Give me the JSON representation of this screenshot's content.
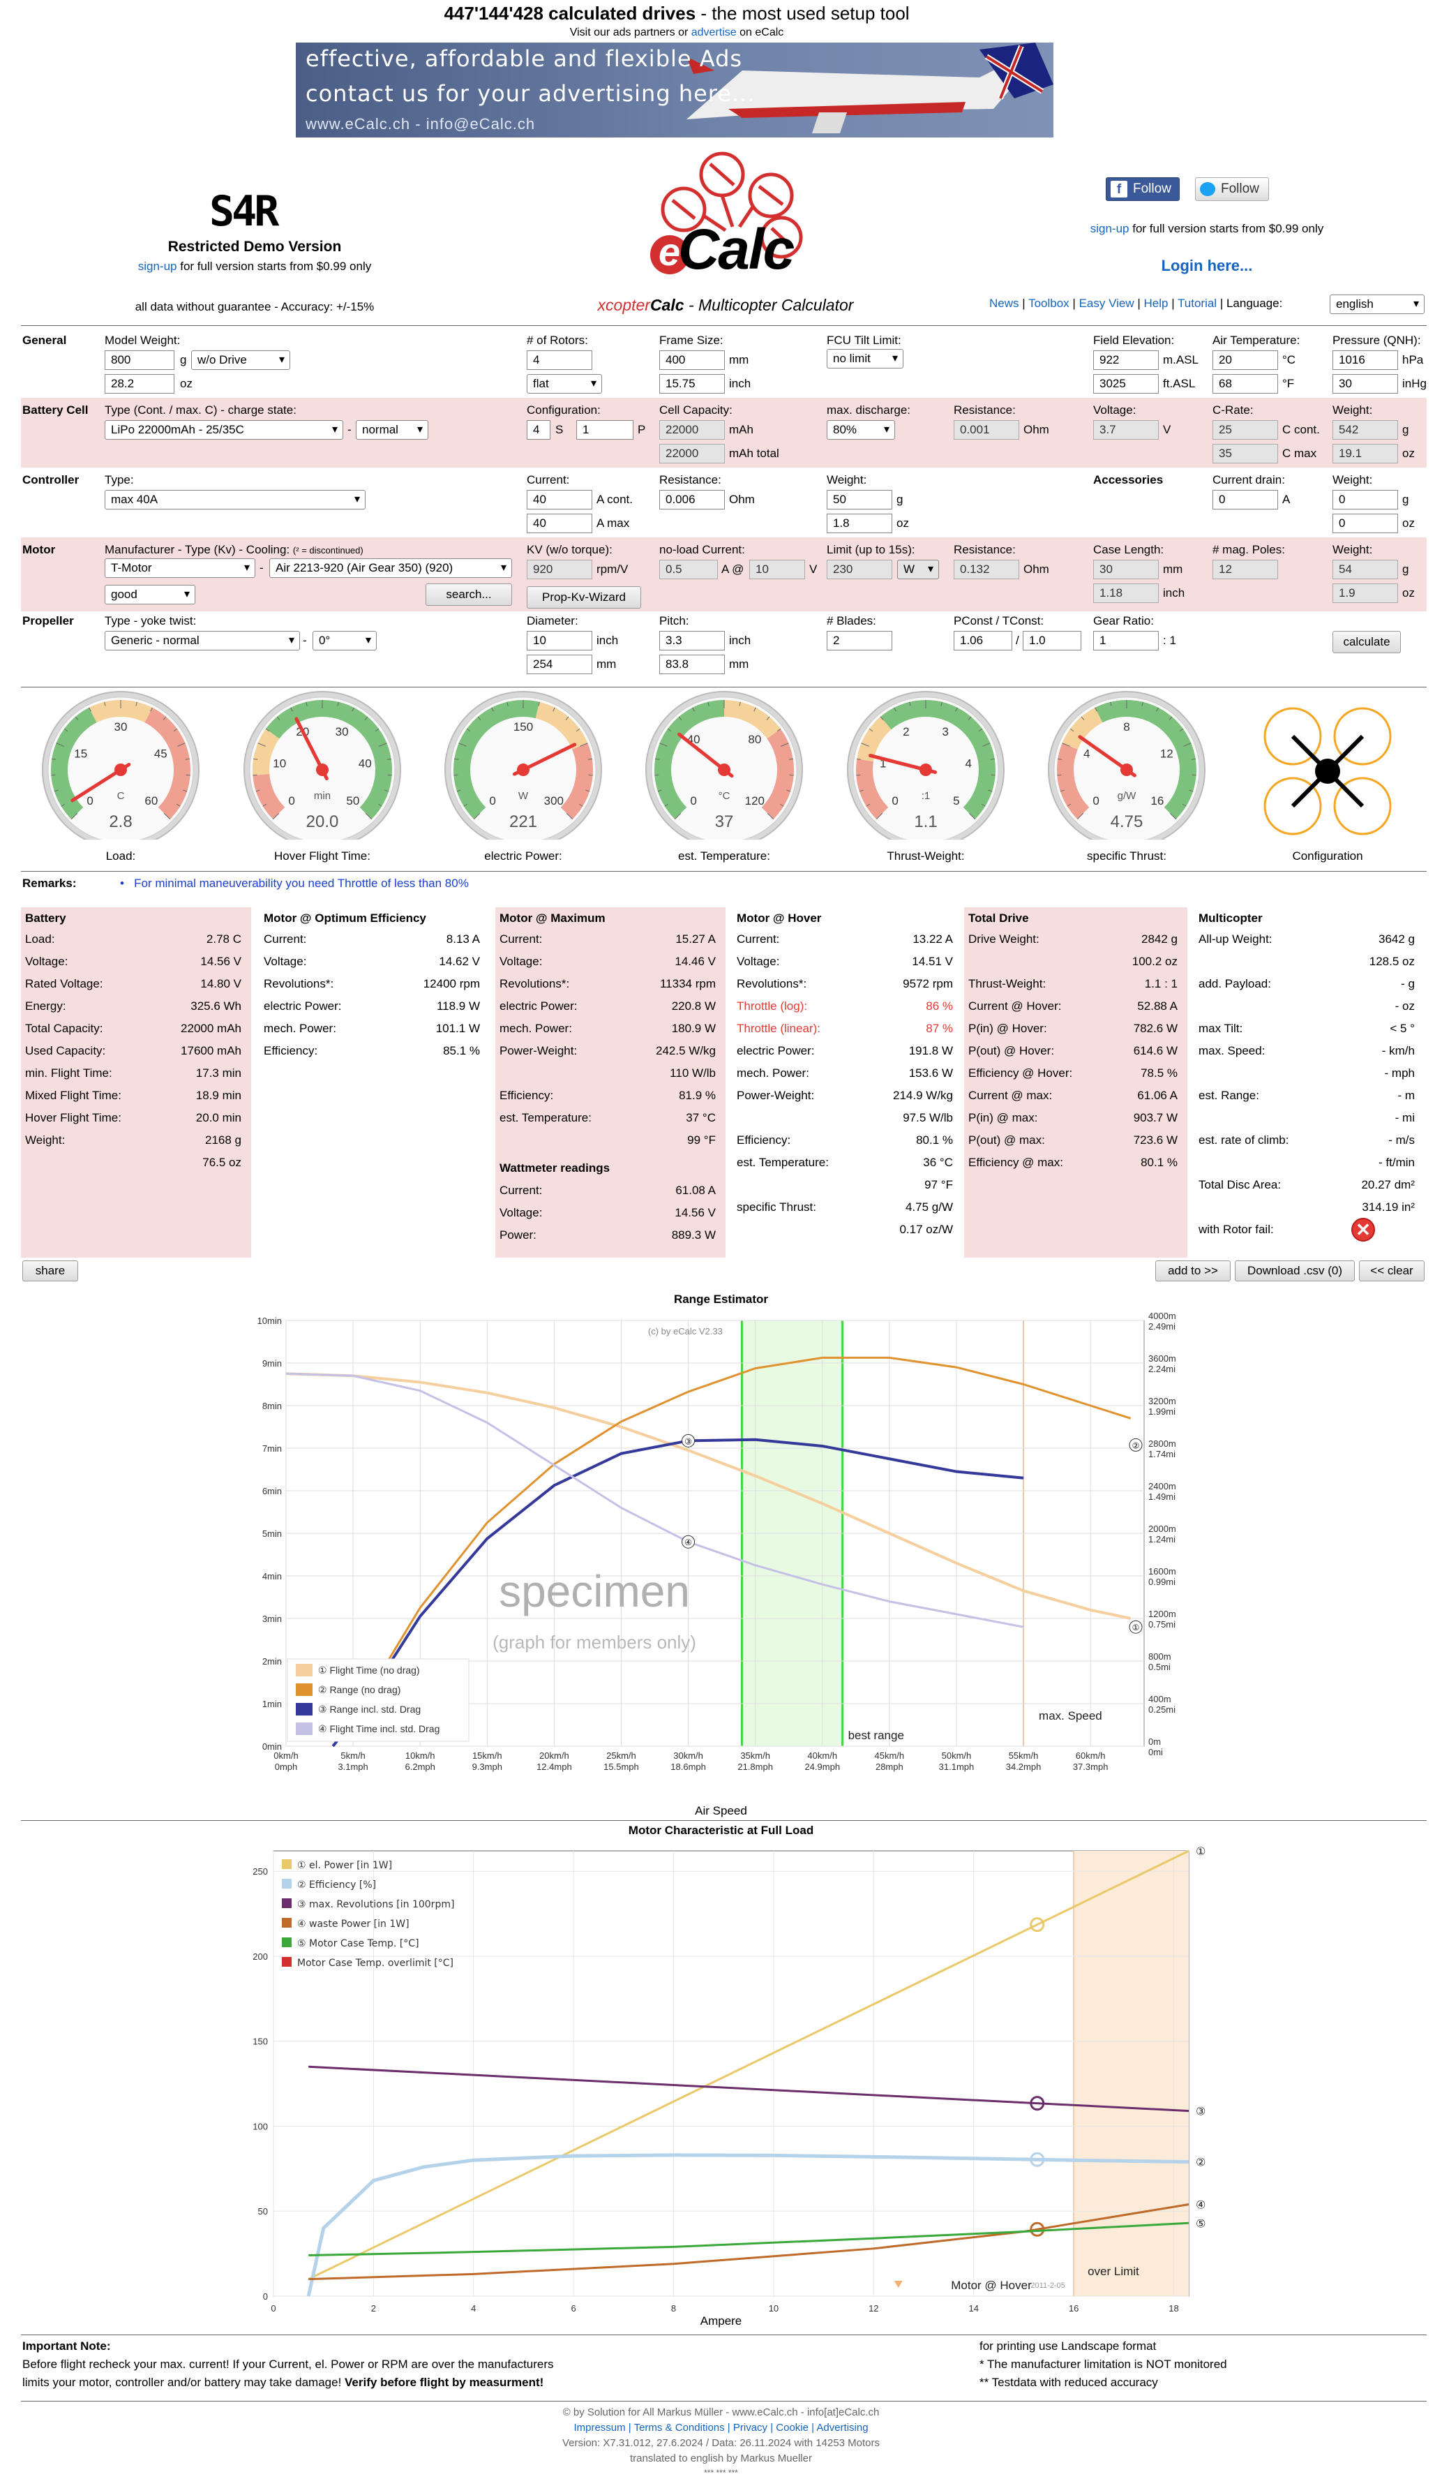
{
  "top": {
    "count": "447'144'428 calculated drives",
    "tagline": " - the most used setup tool",
    "visit_pre": "Visit our ads partners or ",
    "visit_link": "advertise",
    "visit_post": " on eCalc"
  },
  "ad": {
    "line1": "effective, affordable and flexible Ads",
    "line2": "contact us for your advertising here...",
    "line3": "www.eCalc.ch - info@eCalc.ch"
  },
  "header": {
    "user_code": "S4R",
    "demo": "Restricted Demo Version",
    "signup": "sign-up",
    "signup_rest": " for full version starts from $0.99 only",
    "guarantee": "all data without guarantee - Accuracy: +/-15%",
    "logo": "Calc",
    "logo_e": "e",
    "app_name_a": "xcopter",
    "app_name_b": "Calc",
    "app_name_c": " - Multicopter Calculator",
    "follow1": "Follow",
    "follow2": "Follow",
    "signup2": "sign-up",
    "signup2_rest": " for full version starts from $0.99 only",
    "login": "Login here...",
    "nav": [
      "News",
      "Toolbox",
      "Easy View",
      "Help",
      "Tutorial"
    ],
    "lang_label": "Language:",
    "lang": "english"
  },
  "general": {
    "title": "General",
    "weight_label": "Model Weight:",
    "weight_g": "800",
    "unit_g": "g",
    "drive": "w/o Drive",
    "weight_oz": "28.2",
    "unit_oz": "oz",
    "rotors_label": "# of Rotors:",
    "rotors": "4",
    "rotor_cfg": "flat",
    "frame_label": "Frame Size:",
    "frame_mm": "400",
    "unit_mm": "mm",
    "frame_inch": "15.75",
    "unit_inch": "inch",
    "fcu_label": "FCU Tilt Limit:",
    "fcu": "no limit",
    "elev_label": "Field Elevation:",
    "elev_m": "922",
    "unit_masl": "m.ASL",
    "elev_ft": "3025",
    "unit_ftasl": "ft.ASL",
    "temp_label": "Air Temperature:",
    "temp_c": "20",
    "unit_c": "°C",
    "temp_f": "68",
    "unit_f": "°F",
    "qnh_label": "Pressure (QNH):",
    "qnh_hpa": "1016",
    "unit_hpa": "hPa",
    "qnh_inhg": "30",
    "unit_inhg": "inHg"
  },
  "battery": {
    "title": "Battery Cell",
    "type_label": "Type (Cont. / max. C) - charge state:",
    "type": "LiPo 22000mAh - 25/35C",
    "state": "normal",
    "cfg_label": "Configuration:",
    "s": "4",
    "unit_s": "S",
    "p": "1",
    "unit_p": "P",
    "cap_label": "Cell Capacity:",
    "cap": "22000",
    "unit_mah": "mAh",
    "cap_total": "22000",
    "unit_mah_total": "mAh total",
    "disch_label": "max. discharge:",
    "disch": "80%",
    "res_label": "Resistance:",
    "res": "0.001",
    "unit_ohm": "Ohm",
    "volt_label": "Voltage:",
    "volt": "3.7",
    "unit_v": "V",
    "crate_label": "C-Rate:",
    "c_cont": "25",
    "unit_ccont": "C cont.",
    "c_max": "35",
    "unit_cmax": "C max",
    "w_label": "Weight:",
    "w_g": "542",
    "unit_g": "g",
    "w_oz": "19.1",
    "unit_oz": "oz"
  },
  "controller": {
    "title": "Controller",
    "type_label": "Type:",
    "type": "max 40A",
    "cur_label": "Current:",
    "cur_cont": "40",
    "unit_acont": "A cont.",
    "cur_max": "40",
    "unit_amax": "A max",
    "res_label": "Resistance:",
    "res": "0.006",
    "unit_ohm": "Ohm",
    "w_label": "Weight:",
    "w_g": "50",
    "unit_g": "g",
    "w_oz": "1.8",
    "unit_oz": "oz",
    "acc_title": "Accessories",
    "drain_label": "Current drain:",
    "drain": "0",
    "unit_a": "A",
    "acc_w_label": "Weight:",
    "acc_w_g": "0",
    "acc_unit_g": "g",
    "acc_w_oz": "0",
    "acc_unit_oz": "oz"
  },
  "motor": {
    "title": "Motor",
    "type_label": "Manufacturer - Type (Kv) - Cooling:",
    "disc_note": "(² = discontinued)",
    "manuf": "T-Motor",
    "model": "Air 2213-920 (Air Gear 350) (920)",
    "cooling": "good",
    "search": "search...",
    "kv_label": "KV (w/o torque):",
    "kv": "920",
    "unit_rpmv": "rpm/V",
    "wizard": "Prop-Kv-Wizard",
    "nl_label": "no-load Current:",
    "nl_a": "0.5",
    "unit_a_at": "A @",
    "nl_v": "10",
    "unit_v": "V",
    "limit_label": "Limit (up to 15s):",
    "limit": "230",
    "limit_unit": "W",
    "res_label": "Resistance:",
    "res": "0.132",
    "unit_ohm": "Ohm",
    "case_label": "Case Length:",
    "case_mm": "30",
    "unit_mm": "mm",
    "case_inch": "1.18",
    "unit_inch": "inch",
    "poles_label": "# mag. Poles:",
    "poles": "12",
    "w_label": "Weight:",
    "w_g": "54",
    "unit_g": "g",
    "w_oz": "1.9",
    "unit_oz": "oz"
  },
  "propeller": {
    "title": "Propeller",
    "type_label": "Type - yoke twist:",
    "type": "Generic - normal",
    "twist": "0°",
    "dia_label": "Diameter:",
    "dia_inch": "10",
    "unit_inch": "inch",
    "dia_mm": "254",
    "unit_mm": "mm",
    "pitch_label": "Pitch:",
    "pitch_inch": "3.3",
    "unit_inch2": "inch",
    "pitch_mm": "83.8",
    "unit_mm2": "mm",
    "blades_label": "# Blades:",
    "blades": "2",
    "pconst_label": "PConst / TConst:",
    "pconst": "1.06",
    "slash": "/",
    "tconst": "1.0",
    "gear_label": "Gear Ratio:",
    "gear": "1",
    "gear_unit": ": 1",
    "calc": "calculate"
  },
  "gauges": [
    {
      "name": "Load:",
      "value": "2.8",
      "unit": "C",
      "ticks": [
        "0",
        "15",
        "30",
        "45",
        "60"
      ],
      "min": 0,
      "max": 60,
      "needle": 2.8
    },
    {
      "name": "Hover Flight Time:",
      "value": "20.0",
      "unit": "min",
      "ticks": [
        "0",
        "10",
        "20",
        "30",
        "40",
        "50"
      ],
      "min": 0,
      "max": 50,
      "needle": 20
    },
    {
      "name": "electric Power:",
      "value": "221",
      "unit": "W",
      "ticks": [
        "0",
        "150",
        "300"
      ],
      "min": 0,
      "max": 300,
      "needle": 221
    },
    {
      "name": "est. Temperature:",
      "value": "37",
      "unit": "°C",
      "ticks": [
        "0",
        "40",
        "80",
        "120"
      ],
      "min": 0,
      "max": 120,
      "needle": 37
    },
    {
      "name": "Thrust-Weight:",
      "value": "1.1",
      "unit": ":1",
      "ticks": [
        "0",
        "1",
        "2",
        "3",
        "4",
        "5"
      ],
      "min": 0,
      "max": 5,
      "needle": 1.1
    },
    {
      "name": "specific Thrust:",
      "value": "4.75",
      "unit": "g/W",
      "ticks": [
        "0",
        "4",
        "8",
        "12",
        "16"
      ],
      "min": 0,
      "max": 16,
      "needle": 4.75
    }
  ],
  "config_label": "Configuration",
  "remarks": {
    "title": "Remarks:",
    "text": "For minimal maneuverability you need Throttle of less than 80%"
  },
  "battery_res": {
    "title": "Battery",
    "rows": [
      [
        "Load:",
        "2.78 C"
      ],
      [
        "Voltage:",
        "14.56 V"
      ],
      [
        "Rated Voltage:",
        "14.80 V"
      ],
      [
        "Energy:",
        "325.6 Wh"
      ],
      [
        "Total Capacity:",
        "22000 mAh"
      ],
      [
        "Used Capacity:",
        "17600 mAh"
      ],
      [
        "min. Flight Time:",
        "17.3 min"
      ],
      [
        "Mixed Flight Time:",
        "18.9 min"
      ],
      [
        "Hover Flight Time:",
        "20.0 min"
      ],
      [
        "Weight:",
        "2168 g"
      ],
      [
        "",
        "76.5 oz"
      ]
    ]
  },
  "opt_res": {
    "title": "Motor @ Optimum Efficiency",
    "rows": [
      [
        "Current:",
        "8.13 A"
      ],
      [
        "Voltage:",
        "14.62 V"
      ],
      [
        "Revolutions*:",
        "12400 rpm"
      ],
      [
        "electric Power:",
        "118.9 W"
      ],
      [
        "mech. Power:",
        "101.1 W"
      ],
      [
        "Efficiency:",
        "85.1 %"
      ]
    ]
  },
  "max_res": {
    "title": "Motor @ Maximum",
    "rows": [
      [
        "Current:",
        "15.27 A"
      ],
      [
        "Voltage:",
        "14.46 V"
      ],
      [
        "Revolutions*:",
        "11334 rpm"
      ],
      [
        "electric Power:",
        "220.8 W"
      ],
      [
        "mech. Power:",
        "180.9 W"
      ],
      [
        "Power-Weight:",
        "242.5 W/kg"
      ],
      [
        "",
        "110 W/lb"
      ],
      [
        "Efficiency:",
        "81.9 %"
      ],
      [
        "est. Temperature:",
        "37 °C"
      ],
      [
        "",
        "99 °F"
      ]
    ],
    "watt_title": "Wattmeter readings",
    "watt_rows": [
      [
        "Current:",
        "61.08 A"
      ],
      [
        "Voltage:",
        "14.56 V"
      ],
      [
        "Power:",
        "889.3 W"
      ]
    ]
  },
  "hover_res": {
    "title": "Motor @ Hover",
    "rows": [
      [
        "Current:",
        "13.22 A"
      ],
      [
        "Voltage:",
        "14.51 V"
      ],
      [
        "Revolutions*:",
        "9572 rpm"
      ],
      [
        "Throttle (log):",
        "86 %"
      ],
      [
        "Throttle (linear):",
        "87 %"
      ],
      [
        "electric Power:",
        "191.8 W"
      ],
      [
        "mech. Power:",
        "153.6 W"
      ],
      [
        "Power-Weight:",
        "214.9 W/kg"
      ],
      [
        "",
        "97.5 W/lb"
      ],
      [
        "Efficiency:",
        "80.1 %"
      ],
      [
        "est. Temperature:",
        "36 °C"
      ],
      [
        "",
        "97 °F"
      ],
      [
        "specific Thrust:",
        "4.75 g/W"
      ],
      [
        "",
        "0.17 oz/W"
      ]
    ]
  },
  "drive_res": {
    "title": "Total Drive",
    "rows": [
      [
        "Drive Weight:",
        "2842 g"
      ],
      [
        "",
        "100.2 oz"
      ],
      [
        "Thrust-Weight:",
        "1.1 : 1"
      ],
      [
        "Current @ Hover:",
        "52.88 A"
      ],
      [
        "P(in) @ Hover:",
        "782.6 W"
      ],
      [
        "P(out) @ Hover:",
        "614.6 W"
      ],
      [
        "Efficiency @ Hover:",
        "78.5 %"
      ],
      [
        "Current @ max:",
        "61.06 A"
      ],
      [
        "P(in) @ max:",
        "903.7 W"
      ],
      [
        "P(out) @ max:",
        "723.6 W"
      ],
      [
        "Efficiency @ max:",
        "80.1 %"
      ]
    ]
  },
  "multi_res": {
    "title": "Multicopter",
    "rows": [
      [
        "All-up Weight:",
        "3642 g"
      ],
      [
        "",
        "128.5 oz"
      ],
      [
        "add. Payload:",
        "- g"
      ],
      [
        "",
        "- oz"
      ],
      [
        "max Tilt:",
        "< 5 °"
      ],
      [
        "max. Speed:",
        "- km/h"
      ],
      [
        "",
        "- mph"
      ],
      [
        "est. Range:",
        "- m"
      ],
      [
        "",
        "- mi"
      ],
      [
        "est. rate of climb:",
        "- m/s"
      ],
      [
        "",
        "- ft/min"
      ],
      [
        "Total Disc Area:",
        "20.27 dm²"
      ],
      [
        "",
        "314.19 in²"
      ],
      [
        "with Rotor fail:",
        ""
      ]
    ]
  },
  "actions": {
    "share": "share",
    "add": "add to >>",
    "download": "Download .csv (0)",
    "clear": "<< clear"
  },
  "range_chart": {
    "title": "Range Estimator",
    "copyright": "(c) by eCalc  V2.33",
    "specimen": "specimen",
    "specimen_sub": "(graph for members only)",
    "xlabel": "Air Speed",
    "best": "best range",
    "maxspeed": "max. Speed",
    "chart_data": {
      "type": "line",
      "x_kmh": [
        0,
        5,
        10,
        15,
        20,
        25,
        30,
        35,
        40,
        45,
        50,
        55,
        60
      ],
      "x_ticks_kmh": [
        "0km/h",
        "5km/h",
        "10km/h",
        "15km/h",
        "20km/h",
        "25km/h",
        "30km/h",
        "35km/h",
        "40km/h",
        "45km/h",
        "50km/h",
        "55km/h",
        "60km/h"
      ],
      "x_ticks_mph": [
        "0mph",
        "3.1mph",
        "6.2mph",
        "9.3mph",
        "12.4mph",
        "15.5mph",
        "18.6mph",
        "21.8mph",
        "24.9mph",
        "28mph",
        "31.1mph",
        "34.2mph",
        "37.3mph"
      ],
      "y_left_ticks": [
        "0min",
        "1min",
        "2min",
        "3min",
        "4min",
        "5min",
        "6min",
        "7min",
        "8min",
        "9min",
        "10min"
      ],
      "y_right_ticks": [
        "0m 0mi",
        "400m 0.25mi",
        "800m 0.5mi",
        "1200m 0.75mi",
        "1600m 0.99mi",
        "2000m 1.24mi",
        "2400m 1.49mi",
        "2800m 1.74mi",
        "3200m 1.99mi",
        "3600m 2.24mi",
        "4000m 2.49mi"
      ],
      "xlim": [
        0,
        64
      ],
      "ylim_min": [
        0,
        10
      ],
      "ylim_m": [
        0,
        4000
      ],
      "series": [
        {
          "name": "① Flight Time (no drag)",
          "color": "#f5cf9e",
          "axis": "min",
          "x": [
            0,
            5,
            10,
            15,
            20,
            25,
            30,
            35,
            40,
            45,
            50,
            55,
            60,
            63
          ],
          "y": [
            8.75,
            8.7,
            8.55,
            8.3,
            7.95,
            7.5,
            6.95,
            6.35,
            5.7,
            5.0,
            4.3,
            3.65,
            3.2,
            3.0
          ]
        },
        {
          "name": "② Range (no drag)",
          "color": "#e0922f",
          "axis": "m",
          "x": [
            3.5,
            5,
            10,
            15,
            20,
            25,
            30,
            35,
            40,
            45,
            50,
            55,
            60,
            63
          ],
          "y": [
            0,
            260,
            1300,
            2100,
            2650,
            3050,
            3330,
            3550,
            3650,
            3650,
            3560,
            3400,
            3200,
            3080
          ]
        },
        {
          "name": "③ Range incl. std. Drag",
          "color": "#34399a",
          "axis": "m",
          "x": [
            3.5,
            5,
            10,
            15,
            20,
            25,
            30,
            35,
            40,
            45,
            50,
            55
          ],
          "y": [
            0,
            240,
            1220,
            1950,
            2450,
            2750,
            2870,
            2880,
            2820,
            2700,
            2580,
            2520
          ]
        },
        {
          "name": "④ Flight Time incl. std. Drag",
          "color": "#c4c0e6",
          "axis": "min",
          "x": [
            0,
            5,
            10,
            15,
            20,
            25,
            30,
            35,
            40,
            45,
            50,
            55
          ],
          "y": [
            8.75,
            8.7,
            8.35,
            7.6,
            6.6,
            5.6,
            4.8,
            4.25,
            3.8,
            3.4,
            3.1,
            2.8
          ]
        }
      ],
      "best_range_kmh": [
        34,
        41.5
      ],
      "max_speed_kmh": 55
    }
  },
  "motor_chart": {
    "title": "Motor Characteristic at Full Load",
    "xlabel": "Ampere",
    "overlimit": "over Limit",
    "hover": "Motor @ Hover",
    "hover_date": "2011-2-05",
    "chart_data": {
      "type": "line",
      "x_ticks": [
        "0",
        "2",
        "4",
        "6",
        "8",
        "10",
        "12",
        "14",
        "16",
        "18"
      ],
      "y_ticks": [
        "0",
        "50",
        "100",
        "150",
        "200",
        "250"
      ],
      "xlim": [
        0,
        18.3
      ],
      "ylim": [
        0,
        262
      ],
      "overlimit_from": 16,
      "hover_x": 15.27,
      "series": [
        {
          "name": "① el. Power [in 1W]",
          "color": "#e9c96a",
          "x": [
            0.7,
            18.3
          ],
          "y": [
            10,
            262
          ]
        },
        {
          "name": "② Efficiency [%]",
          "color": "#b4d3ea",
          "x": [
            0.7,
            1,
            2,
            3,
            4,
            6,
            8,
            10,
            12,
            14,
            16,
            18.3
          ],
          "y": [
            0,
            40,
            68,
            76,
            80,
            82.5,
            83,
            82.8,
            82,
            81,
            80,
            79
          ]
        },
        {
          "name": "③ max. Revolutions [in 100rpm]",
          "color": "#6b2d6b",
          "x": [
            0.7,
            18.3
          ],
          "y": [
            135,
            109
          ]
        },
        {
          "name": "④ waste Power [in 1W]",
          "color": "#c06a2a",
          "x": [
            0.7,
            4,
            8,
            12,
            15,
            18.3
          ],
          "y": [
            10,
            13,
            19,
            28,
            38,
            54
          ]
        },
        {
          "name": "⑤ Motor Case Temp. [°C]",
          "color": "#3aa83a",
          "x": [
            0.7,
            4,
            8,
            12,
            15,
            18.3
          ],
          "y": [
            24,
            26,
            29,
            34,
            38,
            43
          ]
        },
        {
          "name": "Motor Case Temp. overlimit [°C]",
          "color": "#d32f2f",
          "x": [],
          "y": []
        }
      ]
    }
  },
  "notes": {
    "title": "Important Note:",
    "line1": "Before flight recheck your max. current! If your Current, el. Power or RPM are over the manufacturers",
    "line2a": "limits your motor, controller and/or battery may take damage! ",
    "line2b": "Verify before flight by measurment!",
    "r1": "for printing use Landscape format",
    "r2": "* The manufacturer limitation is NOT monitored",
    "r3": "** Testdata with reduced accuracy"
  },
  "footer": {
    "l1": "© by Solution for All Markus Müller  -  www.eCalc.ch  -  info[at]eCalc.ch",
    "l2": "Impressum | Terms & Conditions | Privacy | Cookie | Advertising",
    "l3": "Version: X7.31.012, 27.6.2024 / Data: 26.11.2024 with 14253 Motors",
    "l4": "translated to english by Markus Mueller",
    "l5": "*** *** ***"
  }
}
